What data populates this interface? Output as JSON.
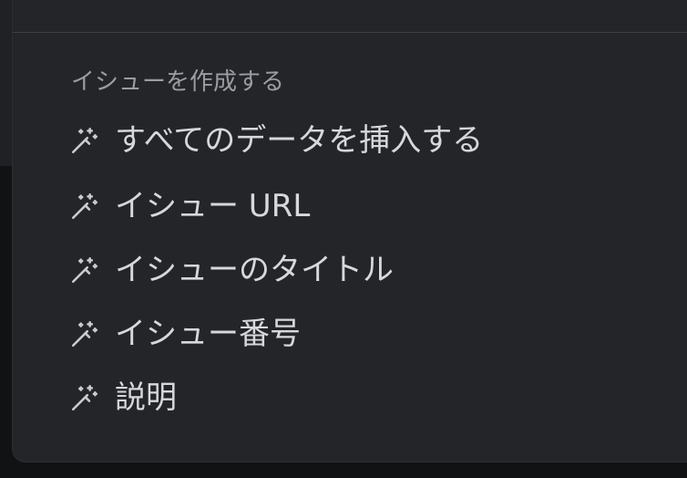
{
  "menu": {
    "section_title": "イシューを作成する",
    "items": [
      {
        "label": "すべてのデータを挿入する",
        "icon": "magic-wand-icon"
      },
      {
        "label": "イシュー URL",
        "icon": "magic-wand-icon"
      },
      {
        "label": "イシューのタイトル",
        "icon": "magic-wand-icon"
      },
      {
        "label": "イシュー番号",
        "icon": "magic-wand-icon"
      },
      {
        "label": "説明",
        "icon": "magic-wand-icon"
      }
    ]
  },
  "colors": {
    "menu_bg": "#232529",
    "text": "#d6d8dc",
    "muted_text": "#9a9da3"
  }
}
